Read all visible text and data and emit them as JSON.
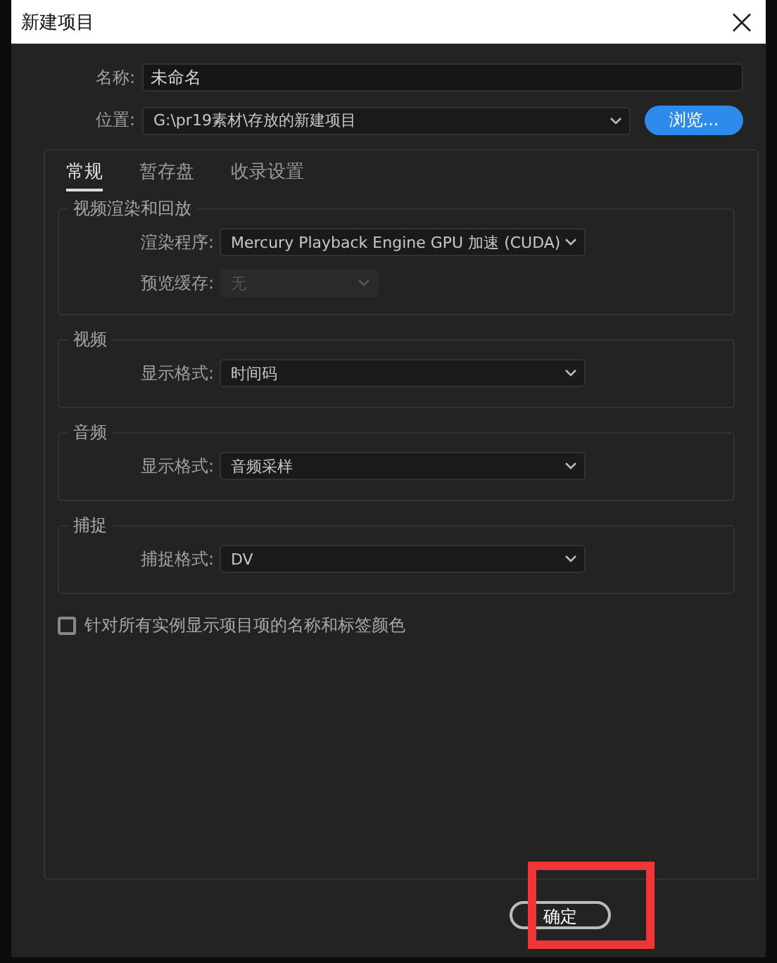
{
  "window": {
    "title": "新建项目"
  },
  "name_field": {
    "label": "名称:",
    "value": "未命名"
  },
  "location_field": {
    "label": "位置:",
    "value": "G:\\pr19素材\\存放的新建项目"
  },
  "browse_button": "浏览...",
  "tabs": [
    {
      "label": "常规",
      "selected": true
    },
    {
      "label": "暂存盘",
      "selected": false
    },
    {
      "label": "收录设置",
      "selected": false
    }
  ],
  "groups": [
    {
      "title": "视频渲染和回放",
      "rows": [
        {
          "label": "渲染程序:",
          "value": "Mercury Playback Engine GPU 加速 (CUDA)",
          "disabled": false
        },
        {
          "label": "预览缓存:",
          "value": "无",
          "disabled": true
        }
      ]
    },
    {
      "title": "视频",
      "rows": [
        {
          "label": "显示格式:",
          "value": "时间码",
          "disabled": false
        }
      ]
    },
    {
      "title": "音频",
      "rows": [
        {
          "label": "显示格式:",
          "value": "音频采样",
          "disabled": false
        }
      ]
    },
    {
      "title": "捕捉",
      "rows": [
        {
          "label": "捕捉格式:",
          "value": "DV",
          "disabled": false
        }
      ]
    }
  ],
  "checkbox": {
    "label": "针对所有实例显示项目项的名称和标签颜色",
    "checked": false
  },
  "ok_button": "确定",
  "highlight": {
    "kind": "annotation",
    "color": "#ef3535"
  }
}
